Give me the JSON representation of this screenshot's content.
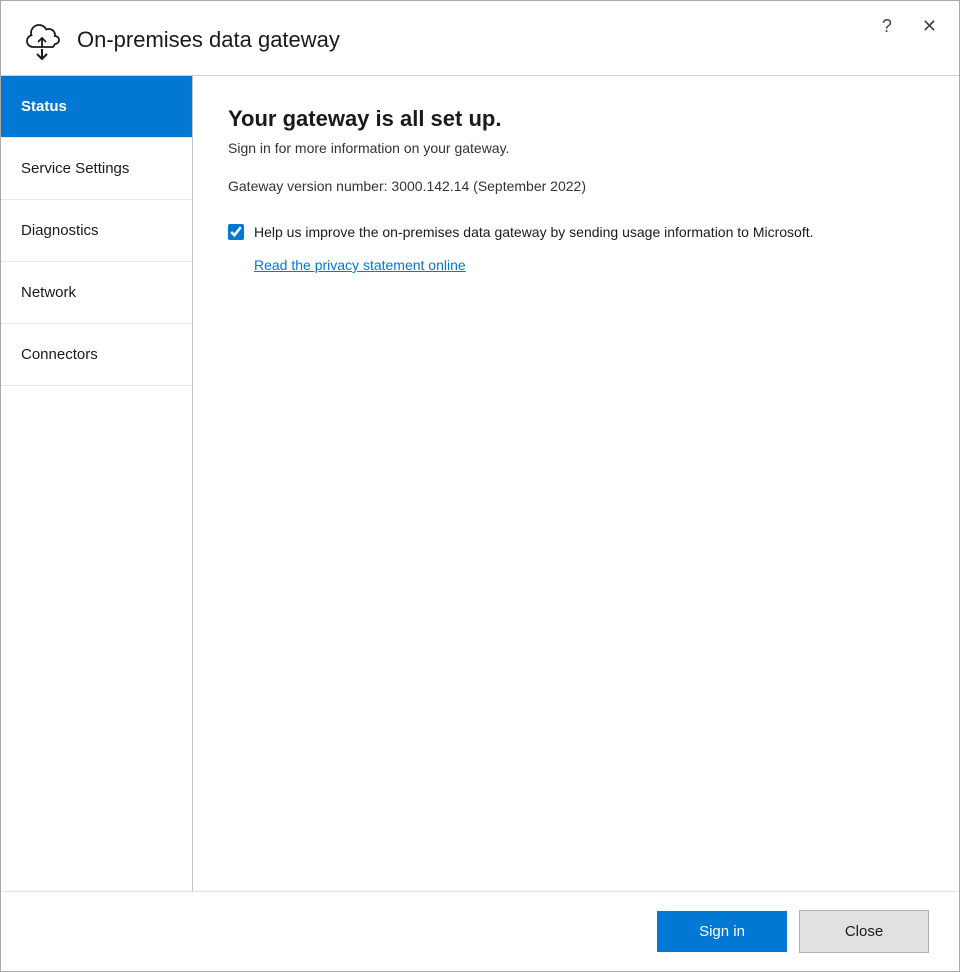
{
  "window": {
    "title": "On-premises data gateway",
    "help_btn": "?",
    "close_btn": "✕"
  },
  "sidebar": {
    "items": [
      {
        "id": "status",
        "label": "Status",
        "active": true
      },
      {
        "id": "service-settings",
        "label": "Service Settings",
        "active": false
      },
      {
        "id": "diagnostics",
        "label": "Diagnostics",
        "active": false
      },
      {
        "id": "network",
        "label": "Network",
        "active": false
      },
      {
        "id": "connectors",
        "label": "Connectors",
        "active": false
      }
    ]
  },
  "main": {
    "status_title": "Your gateway is all set up.",
    "status_subtitle": "Sign in for more information on your gateway.",
    "version_label": "Gateway version number: 3000.142.14 (September 2022)",
    "checkbox_label": "Help us improve the on-premises data gateway by sending usage information to Microsoft.",
    "checkbox_checked": true,
    "privacy_link": "Read the privacy statement online"
  },
  "footer": {
    "signin_label": "Sign in",
    "close_label": "Close"
  }
}
